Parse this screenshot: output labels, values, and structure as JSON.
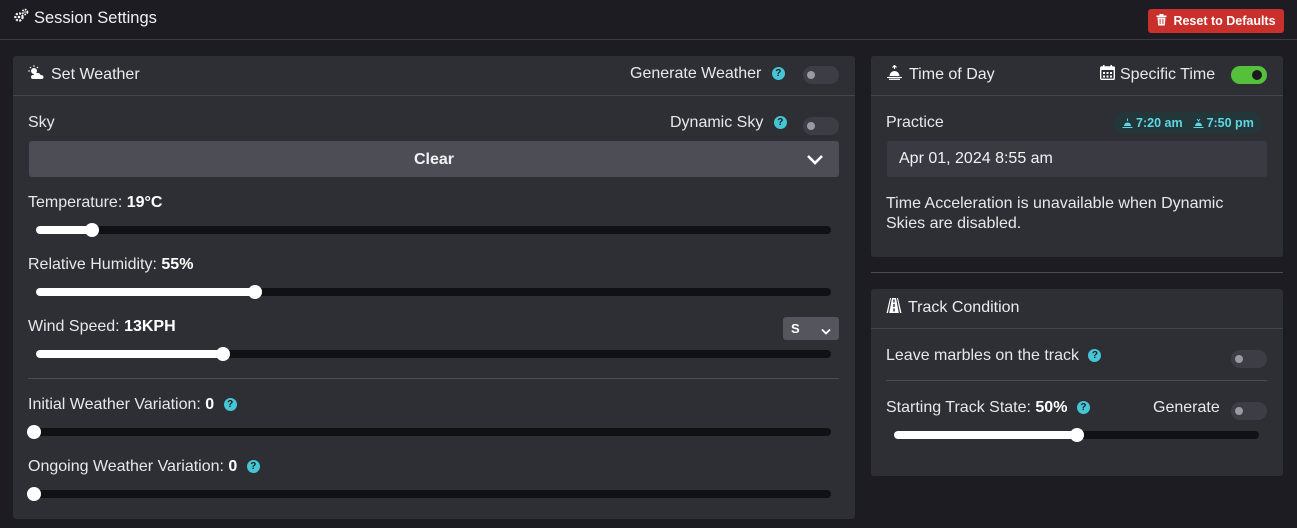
{
  "header": {
    "title": "Session Settings",
    "reset_label": "Reset to Defaults"
  },
  "weather": {
    "title": "Set Weather",
    "generate_label": "Generate Weather",
    "generate_on": false,
    "sky_label": "Sky",
    "dynamic_sky_label": "Dynamic Sky",
    "dynamic_sky_on": false,
    "sky_value": "Clear",
    "temperature_label": "Temperature:",
    "temperature_value": "19°C",
    "temperature_level": 0.07,
    "humidity_label": "Relative Humidity:",
    "humidity_value": "55%",
    "humidity_level": 0.275,
    "wind_label": "Wind Speed:",
    "wind_value": "13KPH",
    "wind_level": 0.235,
    "wind_direction": "S",
    "initial_variation_label": "Initial Weather Variation:",
    "initial_variation_value": "0",
    "initial_variation_level": 0,
    "ongoing_variation_label": "Ongoing Weather Variation:",
    "ongoing_variation_value": "0",
    "ongoing_variation_level": 0
  },
  "time_of_day": {
    "title": "Time of Day",
    "specific_time_label": "Specific Time",
    "specific_time_on": true,
    "session_label": "Practice",
    "sunrise": "7:20 am",
    "sunset": "7:50 pm",
    "date_value": "Apr 01, 2024 8:55 am",
    "note": "Time Acceleration is unavailable when Dynamic Skies are disabled."
  },
  "track": {
    "title": "Track Condition",
    "marbles_label": "Leave marbles on the track",
    "marbles_on": false,
    "starting_state_label": "Starting Track State:",
    "starting_state_value": "50%",
    "starting_state_level": 0.5,
    "generate_label": "Generate",
    "generate_on": false
  },
  "colors": {
    "background": "#1c1c22",
    "panel": "#2e2e35",
    "accent_help": "#46c6d4",
    "toggle_on": "#55c13a",
    "danger": "#c9302c"
  }
}
